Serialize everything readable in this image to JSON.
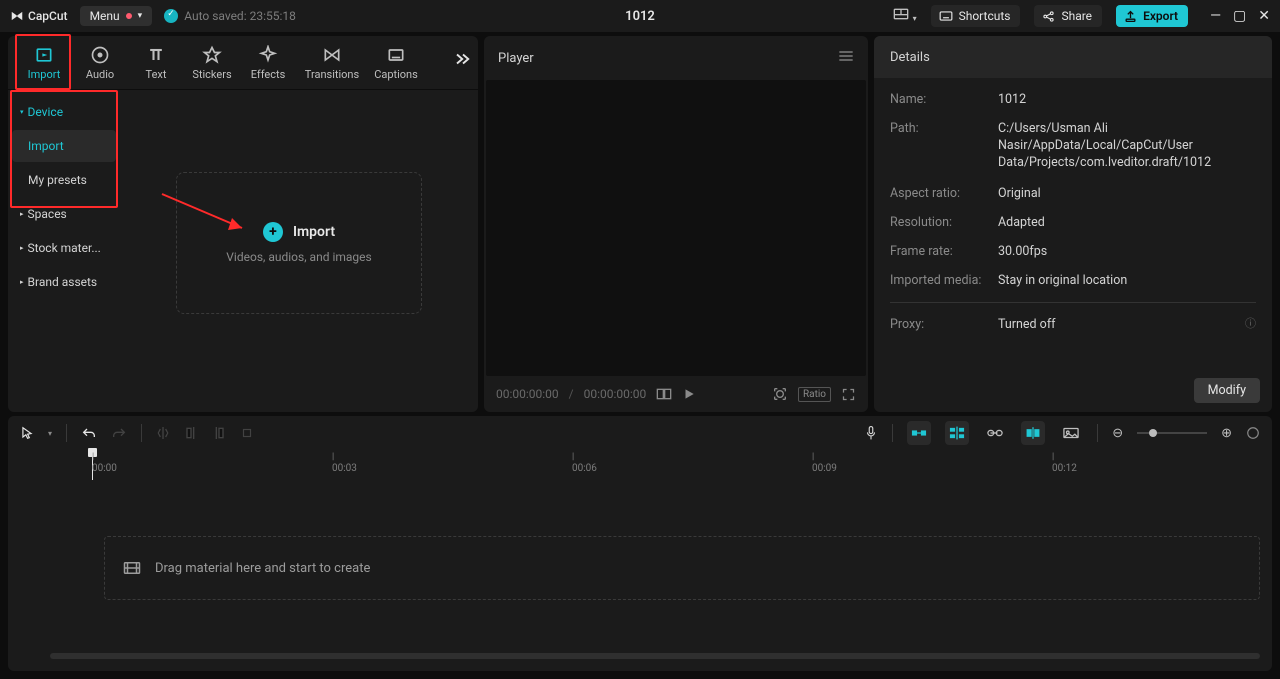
{
  "title": {
    "app_name": "CapCut",
    "menu_label": "Menu",
    "autosaved_label": "Auto saved: 23:55:18",
    "project_title": "1012",
    "shortcuts_label": "Shortcuts",
    "share_label": "Share",
    "export_label": "Export"
  },
  "media_tabs": {
    "import": "Import",
    "audio": "Audio",
    "text": "Text",
    "stickers": "Stickers",
    "effects": "Effects",
    "transitions": "Transitions",
    "captions": "Captions"
  },
  "side": {
    "device": "Device",
    "import": "Import",
    "my_presets": "My presets",
    "spaces": "Spaces",
    "stock": "Stock mater...",
    "brand": "Brand assets"
  },
  "drop": {
    "title": "Import",
    "subtitle": "Videos, audios, and images"
  },
  "player": {
    "title": "Player",
    "time_current": "00:00:00:00",
    "time_total": "00:00:00:00",
    "ratio_label": "Ratio"
  },
  "details": {
    "title": "Details",
    "name_k": "Name:",
    "name_v": "1012",
    "path_k": "Path:",
    "path_v": "C:/Users/Usman Ali Nasir/AppData/Local/CapCut/User Data/Projects/com.lveditor.draft/1012",
    "aspect_k": "Aspect ratio:",
    "aspect_v": "Original",
    "res_k": "Resolution:",
    "res_v": "Adapted",
    "fps_k": "Frame rate:",
    "fps_v": "30.00fps",
    "imported_k": "Imported media:",
    "imported_v": "Stay in original location",
    "proxy_k": "Proxy:",
    "proxy_v": "Turned off",
    "modify": "Modify"
  },
  "timeline": {
    "ticks": [
      "00:00",
      "00:03",
      "00:06",
      "00:09",
      "00:12"
    ],
    "drag_hint": "Drag material here and start to create"
  }
}
